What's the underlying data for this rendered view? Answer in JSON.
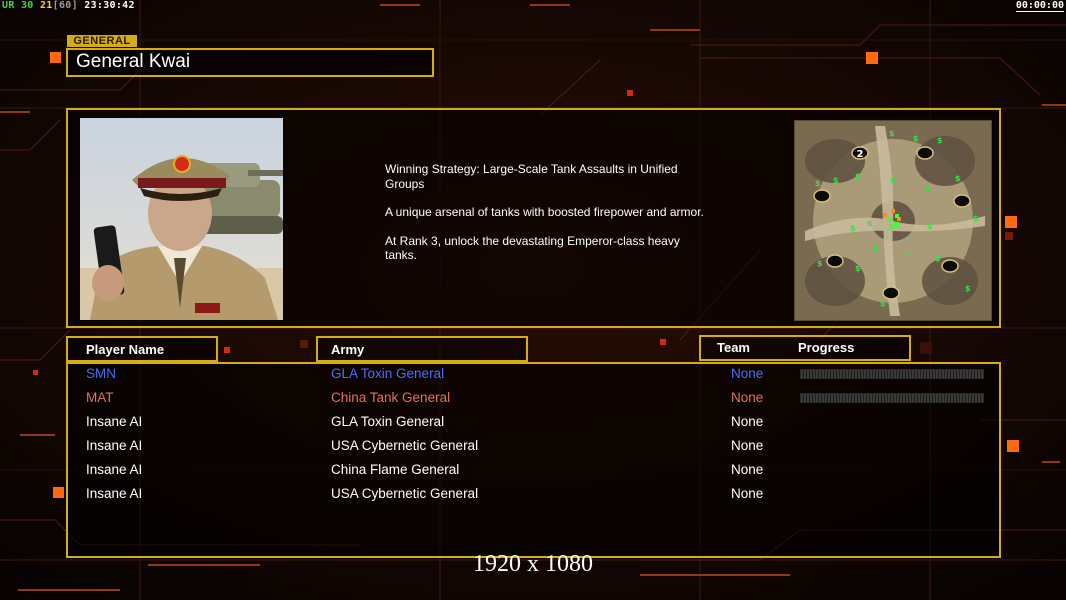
{
  "hud": {
    "ur_label": "UR",
    "ur_value": "30",
    "count": "21",
    "fps": "[60]",
    "clock": "23:30:42",
    "timer": "00:00:00"
  },
  "general": {
    "tag": "GENERAL",
    "name": "General Kwai",
    "description": [
      "Winning Strategy: Large-Scale Tank Assaults in Unified Groups",
      "A unique arsenal of tanks with boosted firepower and armor.",
      "At Rank 3, unlock the devastating Emperor-class heavy tanks."
    ],
    "minimap_player_marker": "2"
  },
  "table": {
    "headers": {
      "player": "Player Name",
      "army": "Army",
      "team": "Team",
      "progress": "Progress"
    },
    "rows": [
      {
        "name": "SMN",
        "army": "GLA Toxin General",
        "team": "None",
        "color": "#4a6cff",
        "has_progress": true
      },
      {
        "name": "MAT",
        "army": "China Tank General",
        "team": "None",
        "color": "#e0735a",
        "has_progress": true
      },
      {
        "name": "Insane AI",
        "army": "GLA Toxin General",
        "team": "None",
        "color": "#ffffff",
        "has_progress": false
      },
      {
        "name": "Insane AI",
        "army": "USA Cybernetic General",
        "team": "None",
        "color": "#ffffff",
        "has_progress": false
      },
      {
        "name": "Insane AI",
        "army": "China Flame General",
        "team": "None",
        "color": "#ffffff",
        "has_progress": false
      },
      {
        "name": "Insane AI",
        "army": "USA Cybernetic General",
        "team": "None",
        "color": "#ffffff",
        "has_progress": false
      }
    ]
  },
  "resolution": "1920 x 1080",
  "colors": {
    "frame_gold": "#d5ad12",
    "accent_orange": "#ff7a1a",
    "background": "#0b0503"
  }
}
